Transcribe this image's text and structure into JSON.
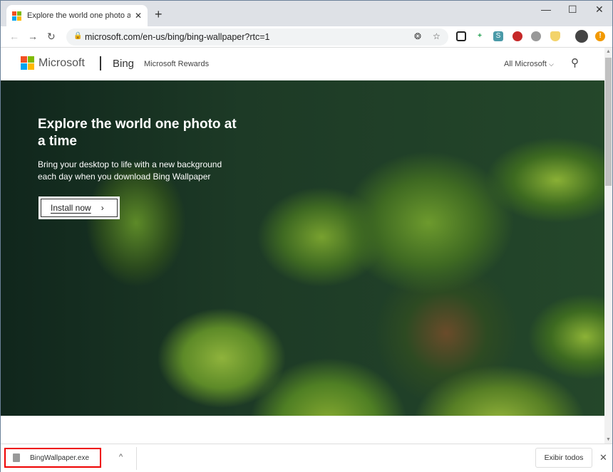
{
  "browser": {
    "tab_title": "Explore the world one photo at a time",
    "url": "microsoft.com/en-us/bing/bing-wallpaper?rtc=1"
  },
  "header": {
    "brand": "Microsoft",
    "product": "Bing",
    "rewards": "Microsoft Rewards",
    "all_microsoft": "All Microsoft"
  },
  "hero": {
    "title": "Explore the world one photo at a time",
    "subtitle": "Bring your desktop to life with a new background each day when you download Bing Wallpaper",
    "install_label": "Install now"
  },
  "download_bar": {
    "file_name": "BingWallpaper.exe",
    "show_all": "Exibir todos"
  },
  "colors": {
    "ms_red": "#f25022",
    "ms_green": "#7fba00",
    "ms_blue": "#00a4ef",
    "ms_yellow": "#ffb900",
    "highlight": "#e00000"
  }
}
